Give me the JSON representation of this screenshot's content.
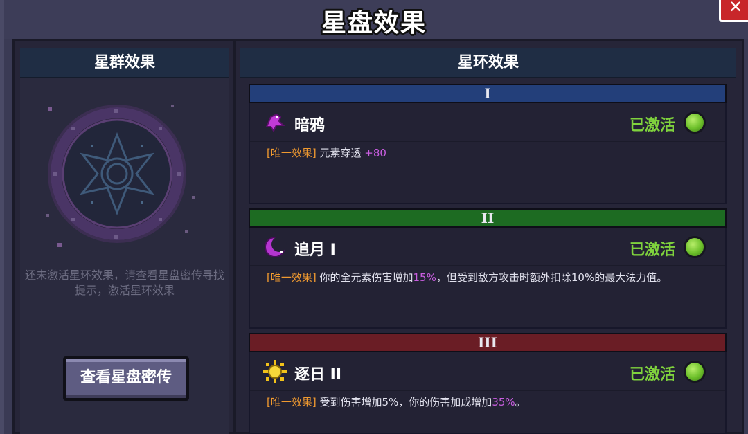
{
  "window": {
    "title": "星盘效果",
    "close_icon": "close-icon"
  },
  "left": {
    "header": "星群效果",
    "hint": "还未激活星环效果，请查看星盘密传寻找提示，激活星环效果",
    "button_label": "查看星盘密传"
  },
  "right": {
    "header": "星环效果",
    "rings": [
      {
        "numeral": "I",
        "bar_color": "#233f7a",
        "name": "暗鸦",
        "icon": "raven-icon",
        "status": "已激活",
        "tag": "[唯一效果]",
        "desc_pre": "元素穿透 ",
        "desc_hl": "+80",
        "desc_post": ""
      },
      {
        "numeral": "II",
        "bar_color": "#1d6b22",
        "name": "追月 I",
        "icon": "crescent-moon-icon",
        "status": "已激活",
        "tag": "[唯一效果]",
        "desc_pre": "你的全元素伤害增加",
        "desc_hl": "15%",
        "desc_post": "，但受到敌方攻击时额外扣除10%的最大法力值。"
      },
      {
        "numeral": "III",
        "bar_color": "#6a1d25",
        "name": "逐日 II",
        "icon": "sun-icon",
        "status": "已激活",
        "tag": "[唯一效果]",
        "desc_pre": "受到伤害增加5%，你的伤害加成增加",
        "desc_hl": "35%",
        "desc_post": "。"
      }
    ]
  },
  "colors": {
    "status_green": "#7fd23d",
    "tag_orange": "#f09a30",
    "highlight_purple": "#c95ee0"
  }
}
